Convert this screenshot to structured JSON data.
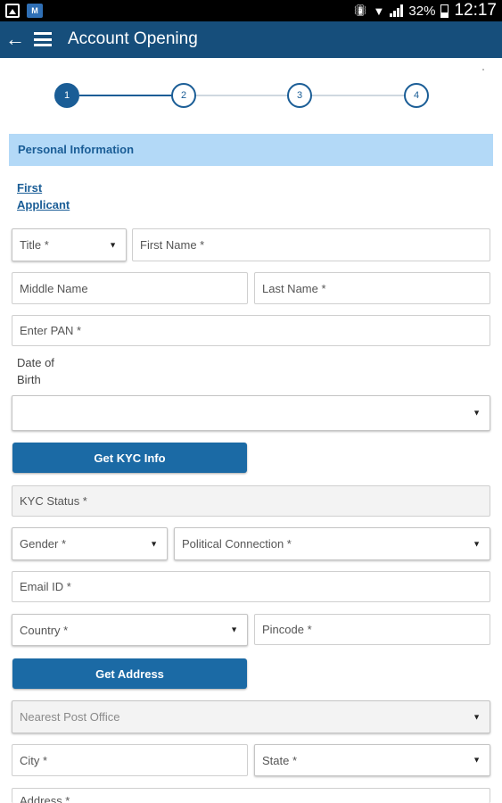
{
  "status_bar": {
    "battery": "32%",
    "time": "12:17",
    "left_icons": [
      "image-icon",
      "app-notification-icon"
    ],
    "app_icon_text": "M"
  },
  "app_bar": {
    "title": "Account Opening",
    "back_icon": "back-arrow-icon",
    "menu_icon": "hamburger-menu-icon",
    "color": "#164e7b"
  },
  "stepper": {
    "current_step": 1,
    "steps": [
      "1",
      "2",
      "3",
      "4"
    ],
    "active_color": "#1a5d96"
  },
  "section": {
    "title": "Personal Information",
    "background": "#b3d9f7"
  },
  "applicant_link": {
    "line1": "First",
    "line2": "Applicant"
  },
  "form": {
    "title_select": "Title *",
    "first_name_placeholder": "First Name *",
    "middle_name_placeholder": "Middle Name",
    "last_name_placeholder": "Last Name *",
    "pan_placeholder": "Enter PAN *",
    "dob_label_line1": "Date of",
    "dob_label_line2": "Birth",
    "dob_value": "",
    "kyc_button": "Get KYC Info",
    "kyc_status_placeholder": "KYC Status *",
    "gender_select": "Gender *",
    "political_select": "Political Connection *",
    "email_placeholder": "Email ID *",
    "country_select": "Country *",
    "pincode_placeholder": "Pincode *",
    "address_button": "Get Address",
    "post_office_select": "Nearest Post Office",
    "city_placeholder": "City *",
    "state_select": "State *",
    "address_placeholder": "Address *"
  },
  "colors": {
    "button": "#1b6aa5",
    "link": "#1a5d96"
  }
}
